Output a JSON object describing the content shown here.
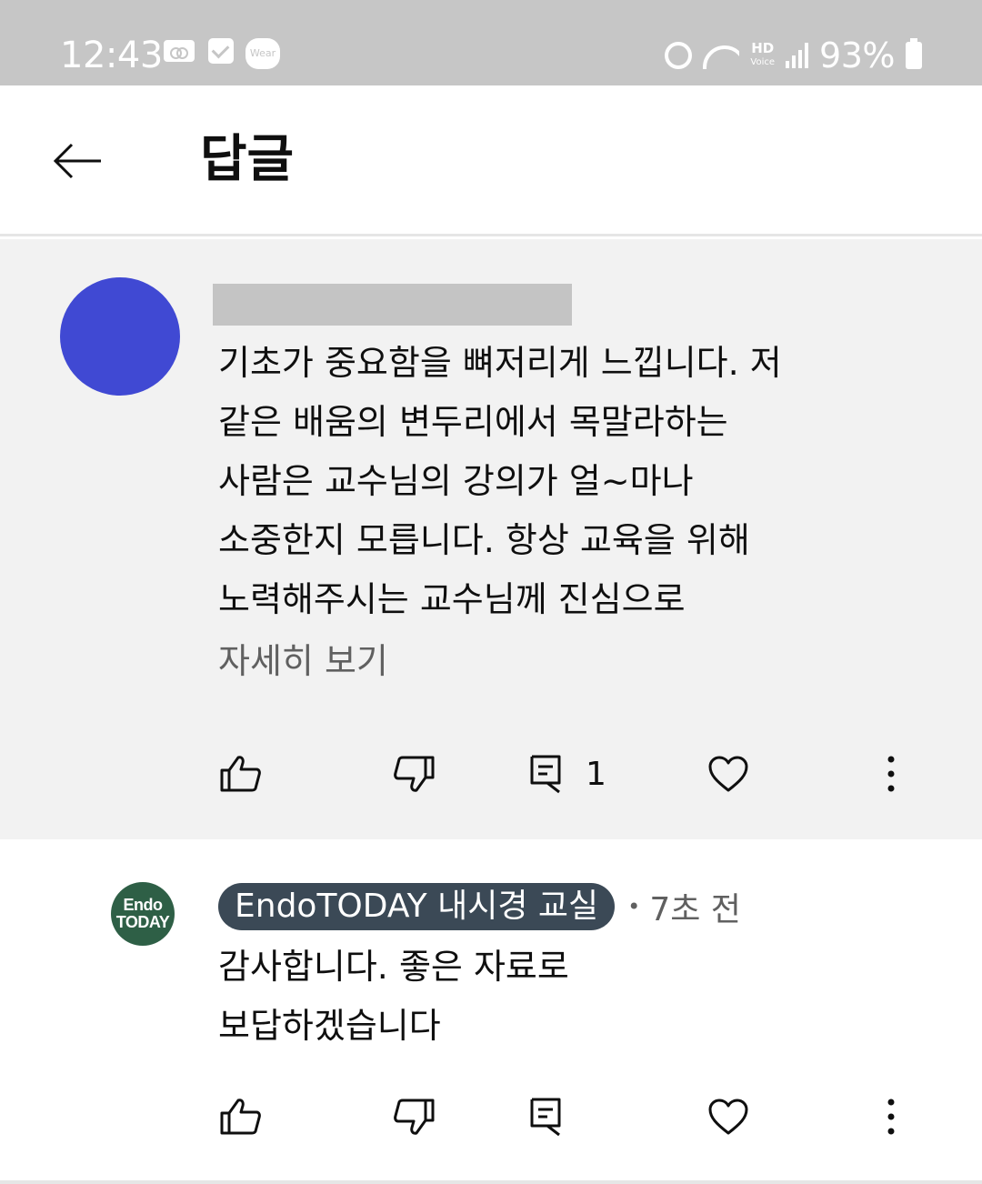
{
  "status_bar": {
    "time": "12:43",
    "wear_label": "Wear",
    "hd_label": "HD",
    "voice_label": "Voice",
    "battery": "93%",
    "icons": [
      "voicemail-icon",
      "check-icon",
      "wear-icon",
      "alarm-icon",
      "wifi-icon",
      "signal-icon",
      "battery-icon"
    ]
  },
  "header": {
    "back_icon": "arrow-left-icon",
    "title": "답글"
  },
  "parent_comment": {
    "avatar_color": "#4049d3",
    "text": "기초가 중요함을 뼈저리게 느낍니다. 저\n같은 배움의 변두리에서 목말라하는\n사람은 교수님의 강의가 얼~마나\n소중한지 모릅니다. 항상 교육을 위해\n노력해주시는 교수님께 진심으로",
    "read_more": "자세히 보기",
    "reply_count": "1"
  },
  "reply_comment": {
    "avatar_line1": "Endo",
    "avatar_line2": "TODAY",
    "avatar_color": "#2e5f46",
    "author": "EndoTODAY 내시경 교실",
    "separator": "•",
    "time": "7초 전",
    "text": "감사합니다. 좋은 자료로\n보답하겠습니다"
  },
  "colors": {
    "status_bar_bg": "#c6c6c6",
    "parent_bg": "#f2f2f2",
    "author_chip_bg": "#3b4956"
  }
}
